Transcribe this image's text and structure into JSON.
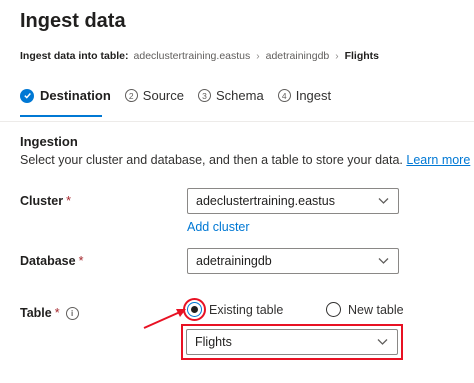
{
  "header": {
    "title": "Ingest data",
    "breadcrumb": {
      "prefix": "Ingest data into table:",
      "cluster": "adeclustertraining.eastus",
      "database": "adetrainingdb",
      "table": "Flights"
    }
  },
  "steps": [
    {
      "num": "",
      "label": "Destination",
      "state": "complete"
    },
    {
      "num": "2",
      "label": "Source"
    },
    {
      "num": "3",
      "label": "Schema"
    },
    {
      "num": "4",
      "label": "Ingest"
    }
  ],
  "ingestion": {
    "title": "Ingestion",
    "description": "Select your cluster and database, and then a table to store your data.",
    "learn_more": "Learn more"
  },
  "fields": {
    "cluster": {
      "label": "Cluster",
      "required_mark": "*",
      "value": "adeclustertraining.eastus",
      "add_link": "Add cluster"
    },
    "database": {
      "label": "Database",
      "required_mark": "*",
      "value": "adetrainingdb"
    },
    "table": {
      "label": "Table",
      "required_mark": "*",
      "options": [
        {
          "label": "Existing table",
          "selected": true
        },
        {
          "label": "New table",
          "selected": false
        }
      ],
      "value": "Flights"
    }
  },
  "colors": {
    "accent": "#0078d4",
    "annotation": "#e81123"
  }
}
